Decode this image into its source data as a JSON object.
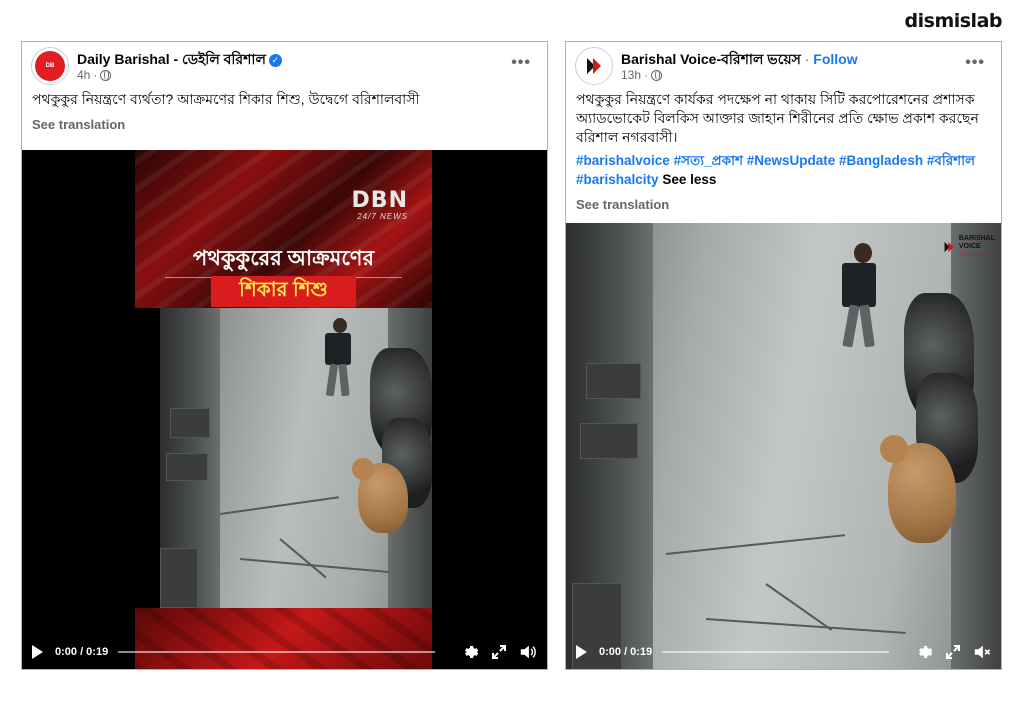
{
  "brand": "dismislab",
  "post1": {
    "page_name": "Daily Barishal - ডেইলি বরিশাল",
    "timestamp": "4h",
    "avatar_text": "DB",
    "caption": "পথকুকুর নিয়ন্ত্রণে ব্যর্থতা? আক্রমণের শিকার শিশু, উদ্বেগে বরিশালবাসী",
    "see_translation": "See translation",
    "video": {
      "logo": "DBN",
      "logo_sub": "24/7 NEWS",
      "headline_line1": "পথকুকুরের আক্রমণের",
      "headline_line2": "শিকার শিশু",
      "time": "0:00 / 0:19"
    }
  },
  "post2": {
    "page_name": "Barishal Voice-বরিশাল ভয়েস",
    "follow": "Follow",
    "timestamp": "13h",
    "caption": "পথকুকুর নিয়ন্ত্রণে কার্যকর পদক্ষেপ না থাকায় সিটি করপোরেশনের প্রশাসক অ্যাডভোকেট বিলকিস আক্তার জাহান শিরীনের প্রতি ক্ষোভ প্রকাশ করছেন বরিশাল নগরবাসী।",
    "hashtags": [
      "#barishalvoice",
      "#সত্য_প্রকাশ",
      "#NewsUpdate",
      "#Bangladesh",
      "#বরিশাল",
      "#barishalcity"
    ],
    "see_less": "See less",
    "see_translation": "See translation",
    "video": {
      "watermark_line1": "BARISHAL",
      "watermark_line2": "VOICE",
      "watermark_line3": "বরিশাল ভয়েস",
      "time": "0:00 / 0:19"
    }
  },
  "colors": {
    "link_blue": "#1877f2",
    "meta_gray": "#65676b",
    "dbn_red": "#d91c1c",
    "headline_yellow": "#ffe44d"
  }
}
